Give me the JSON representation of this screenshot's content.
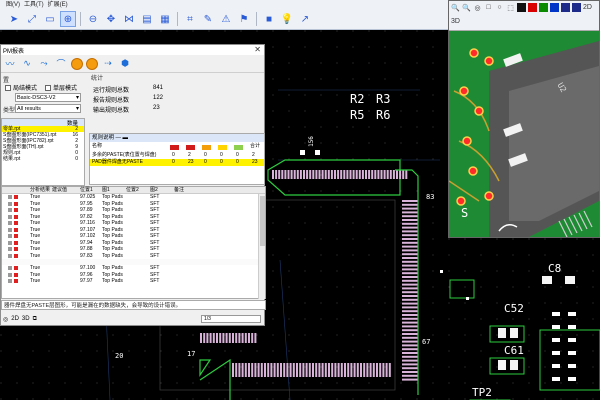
{
  "toolbar": {
    "menu": [
      "图(V)",
      "工具(T)",
      "扩展(E)"
    ],
    "icons": [
      "select-icon",
      "measure-icon",
      "highlight-icon",
      "zoom-in-icon",
      "zoom-out-icon",
      "pan-icon",
      "net-icon",
      "layer-icon",
      "grid-icon",
      "snap-icon",
      "ruler-icon",
      "drc-icon",
      "flag-icon",
      "stop-icon",
      "lamp-icon",
      "arrow-icon"
    ]
  },
  "pcb": {
    "labels": {
      "r2": "R2",
      "r3": "R3",
      "r5": "R5",
      "r6": "R6",
      "c8": "C8",
      "c52": "C52",
      "c61": "C61",
      "tp2": "TP2",
      "n17": "17",
      "n20": "20",
      "n83": "83",
      "n67": "67",
      "n156": "156"
    }
  },
  "dialog": {
    "title": "PM报表",
    "close": "✕",
    "left": {
      "group_label": "置",
      "check1": "局结模式",
      "check2": "单层模式",
      "type_label": "类型",
      "combo1": "Basic-DSC3-V2",
      "combo2": "All results"
    },
    "stats": {
      "group_label": "统计",
      "rows": [
        {
          "label": "运行规则总数",
          "value": "841"
        },
        {
          "label": "报告规则总数",
          "value": "122"
        },
        {
          "label": "输出规则总数",
          "value": "23"
        }
      ]
    },
    "files": {
      "header": "数量",
      "rows": [
        {
          "name": "零单.rpt",
          "count": "2",
          "sel": true
        },
        {
          "name": "S盘图形面(IPC7351).rpt",
          "count": "16",
          "sel": false
        },
        {
          "name": "S盘图形面(IPC782).rpt",
          "count": "2",
          "sel": false
        },
        {
          "name": "S盘图形面(TH).rpt",
          "count": "9",
          "sel": false
        },
        {
          "name": "规则.rpt",
          "count": "0",
          "sel": false
        },
        {
          "name": "结果.rpt",
          "count": "0",
          "sel": false
        }
      ]
    },
    "rules": {
      "header": "规则说明 — ▬",
      "col_name": "名称",
      "col_total": "合计",
      "swatch_colors": [
        "#d11a1a",
        "#d11a1a",
        "#f59e0b",
        "#ffd400",
        "#8fd14f"
      ],
      "rows": [
        {
          "name": "多余的PASTE(表位置与焊盘)",
          "vals": [
            "0",
            "2",
            "0",
            "0",
            "0",
            "2"
          ],
          "sel": false
        },
        {
          "name": "PAD器件焊盘无PASTE",
          "vals": [
            "0",
            "23",
            "0",
            "0",
            "0",
            "23"
          ],
          "sel": true
        }
      ]
    },
    "grid": {
      "headers": [
        "分析结果",
        "建议值",
        "位置1",
        "图1",
        "位置2",
        "图2",
        "备注"
      ],
      "rows": [
        {
          "r": "True",
          "v": "97.025",
          "l": "Top Pads",
          "t": "SFT"
        },
        {
          "r": "True",
          "v": "97.95",
          "l": "Top Pads",
          "t": "SFT"
        },
        {
          "r": "True",
          "v": "97.89",
          "l": "Top Pads",
          "t": "SFT"
        },
        {
          "r": "True",
          "v": "97.82",
          "l": "Top Pads",
          "t": "SFT"
        },
        {
          "r": "True",
          "v": "97.116",
          "l": "Top Pads",
          "t": "SFT"
        },
        {
          "r": "True",
          "v": "97.107",
          "l": "Top Pads",
          "t": "SFT"
        },
        {
          "r": "True",
          "v": "97.102",
          "l": "Top Pads",
          "t": "SFT"
        },
        {
          "r": "True",
          "v": "97.94",
          "l": "Top Pads",
          "t": "SFT"
        },
        {
          "r": "True",
          "v": "97.88",
          "l": "Top Pads",
          "t": "SFT"
        },
        {
          "r": "True",
          "v": "97.83",
          "l": "Top Pads",
          "t": "SFT"
        },
        {
          "r": "",
          "v": "",
          "l": "",
          "t": ""
        },
        {
          "r": "True",
          "v": "97.100",
          "l": "Top Pads",
          "t": "SFT"
        },
        {
          "r": "True",
          "v": "97.96",
          "l": "Top Pads",
          "t": "SFT"
        },
        {
          "r": "True",
          "v": "97.97",
          "l": "Top Pads",
          "t": "SFT"
        }
      ]
    },
    "status": "器件焊盘无PASTE层图形，可能是漏在的数据缺失，会导致的设计错误。",
    "pager": "1/3",
    "footer_icons": [
      "2D",
      "3D"
    ]
  },
  "view3d": {
    "icons": [
      "🔍",
      "🔍",
      "◎",
      "□",
      "○",
      "⬚",
      "■",
      "■",
      "■",
      "■",
      "■",
      "■",
      "2D",
      "3D"
    ],
    "color_blocks": [
      "#111111",
      "#d80000",
      "#0a8a00",
      "#0035c8"
    ],
    "labels": {
      "u1": "U2",
      "s": "S"
    }
  }
}
